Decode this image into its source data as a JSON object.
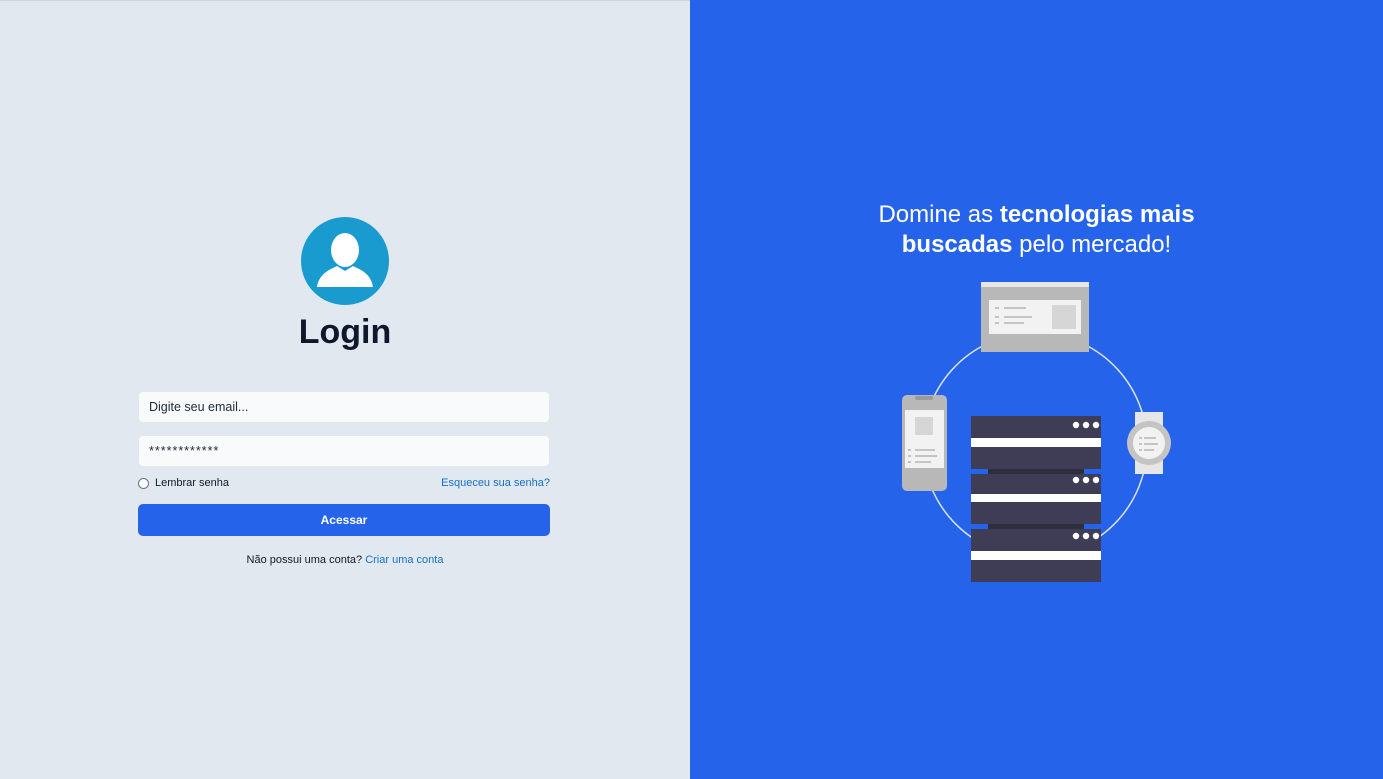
{
  "login": {
    "title": "Login",
    "email_placeholder": "Digite seu email...",
    "password_value": "************",
    "remember_label": "Lembrar senha",
    "forgot_link": "Esqueceu sua senha?",
    "submit_label": "Acessar",
    "signup_prompt": "Não possui uma conta?",
    "signup_link": "Criar uma conta",
    "avatar_icon": "user-silhouette-icon"
  },
  "hero": {
    "line1_normal": "Domine as ",
    "line1_bold": "tecnologias mais",
    "line2_bold": "buscadas",
    "line2_normal": " pelo mercado!",
    "illustration_icons": [
      "browser-window-icon",
      "smartphone-icon",
      "server-rack-icon",
      "smartwatch-icon"
    ]
  },
  "colors": {
    "left_bg": "#e2e8f0",
    "right_bg": "#2563eb",
    "primary_button": "#2563eb",
    "link": "#1570c8",
    "avatar_bg": "#1a9bd0",
    "server": "#3f3d56"
  }
}
